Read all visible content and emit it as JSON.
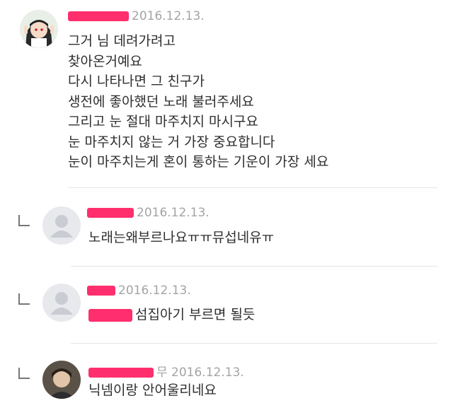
{
  "comments": [
    {
      "name_suffix": "",
      "date": "2016.12.13.",
      "lines": [
        "그거 님 데려가려고",
        "찾아온거예요",
        "다시 나타나면 그 친구가",
        "생전에 좋아했던 노래 불러주세요",
        "그리고 눈 절대 마주치지 마시구요",
        "눈 마주치지 않는 거 가장 중요합니다",
        "눈이 마주치는게 혼이 통하는 기운이 가장 세요"
      ]
    },
    {
      "name_suffix": "",
      "date": "2016.12.13.",
      "text": "노래는왜부르나요ㅠㅠ뮤섭네유ㅠ"
    },
    {
      "name_suffix": "",
      "date": "2016.12.13.",
      "text_suffix": "섬집아기 부르면 될듯"
    },
    {
      "name_suffix": "무",
      "date": "2016.12.13.",
      "text": "닉넴이랑 안어울리네요"
    }
  ],
  "colors": {
    "redaction": "#ff2f6d",
    "meta": "#a4a4a4",
    "divider": "#e6e6e6"
  }
}
